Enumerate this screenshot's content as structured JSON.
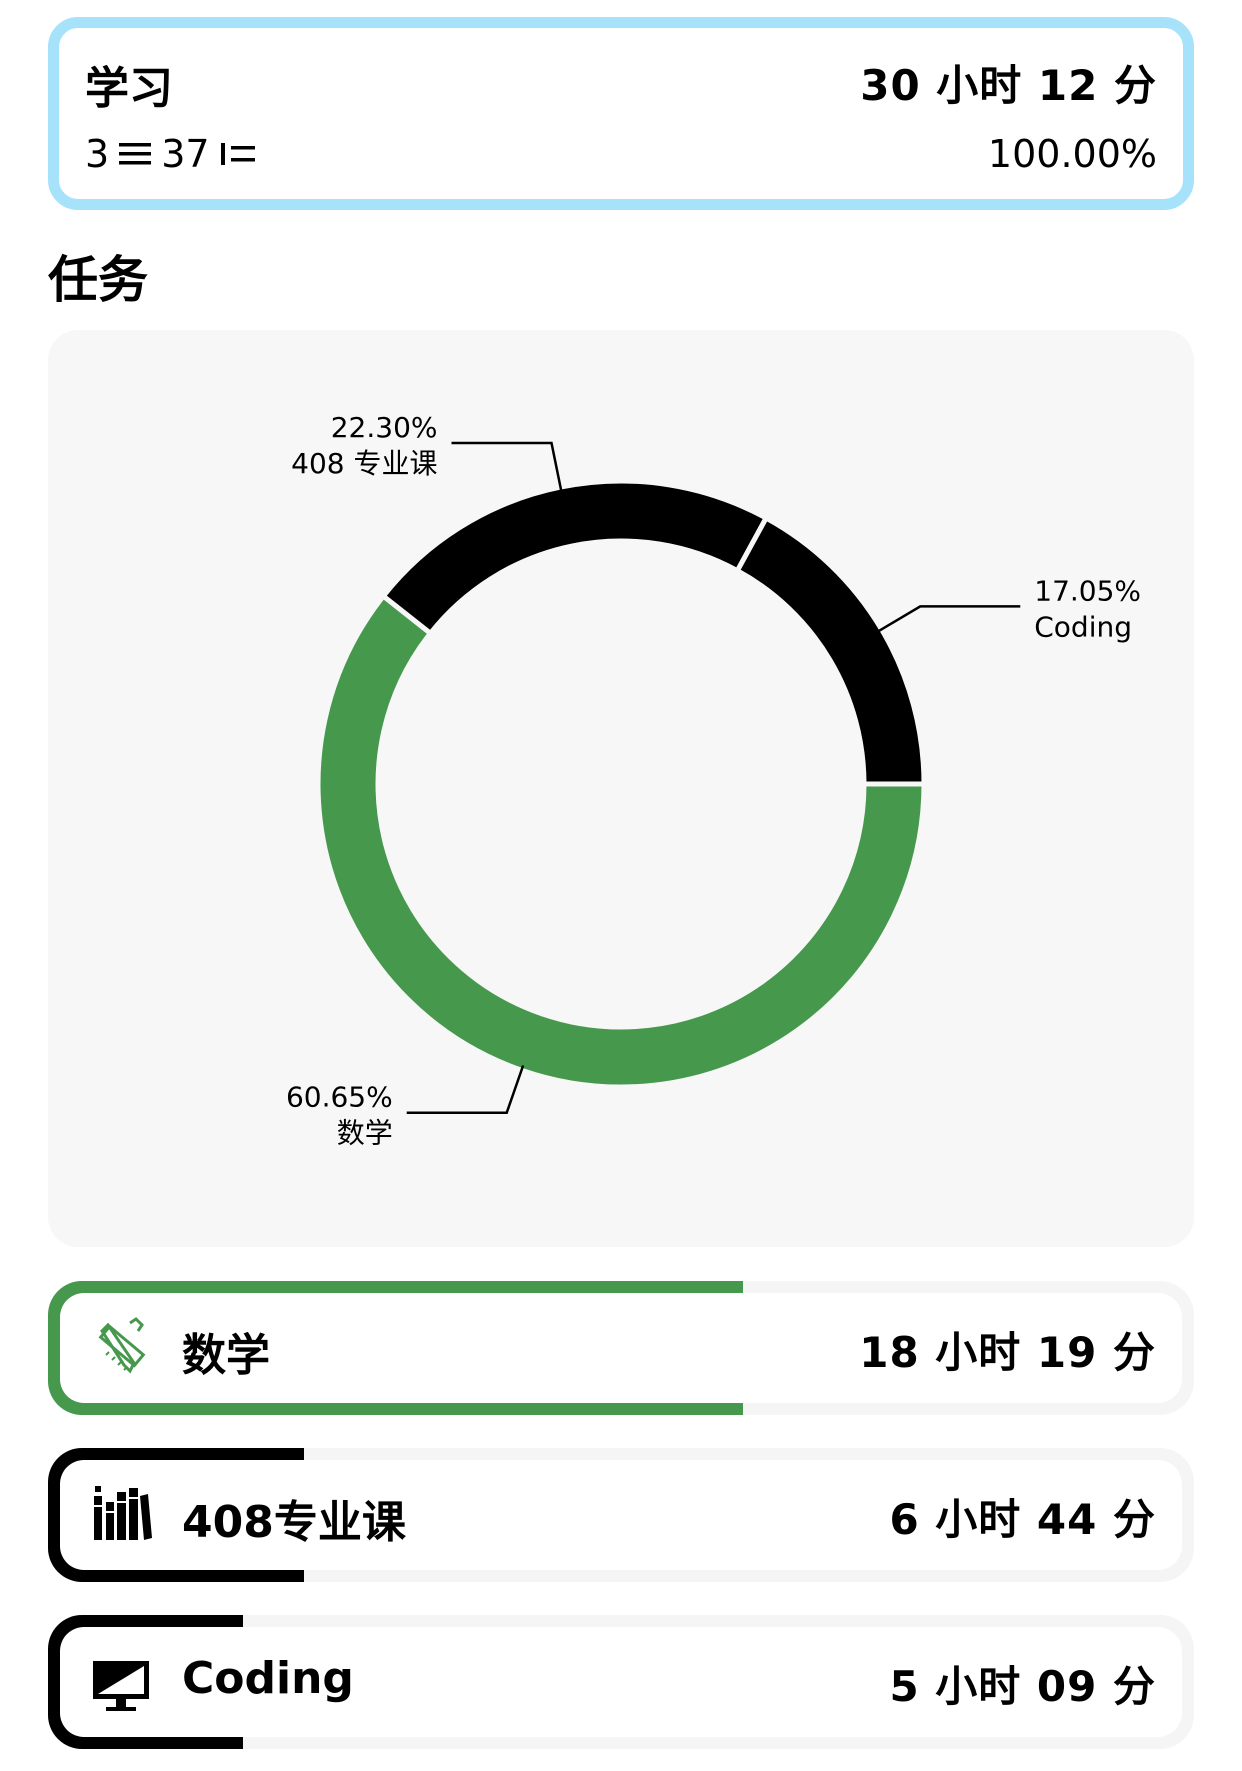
{
  "summary": {
    "title": "学习",
    "total_time": "30 小时 12 分",
    "task_count": "3",
    "record_count": "37",
    "percent": "100.00%",
    "border_color": "#a6e2fa"
  },
  "section": {
    "title": "任务"
  },
  "chart_data": {
    "type": "pie",
    "labels": [
      "数学",
      "408 专业课",
      "Coding"
    ],
    "values": [
      60.65,
      22.3,
      17.05
    ],
    "display": [
      "60.65%",
      "22.30%",
      "17.05%"
    ],
    "colors": [
      "#46994c",
      "#000000",
      "#000000"
    ],
    "donut": true,
    "start_angle": "3 o'clock, clockwise"
  },
  "tasks": [
    {
      "name": "数学",
      "time": "18 小时 19 分",
      "fraction": 0.6065,
      "color": "#46994c",
      "icon": "ruler-pencil-icon"
    },
    {
      "name": "408专业课",
      "time": "6 小时 44 分",
      "fraction": 0.223,
      "color": "#000000",
      "icon": "books-icon"
    },
    {
      "name": "Coding",
      "time": "5 小时 09 分",
      "fraction": 0.1705,
      "color": "#000000",
      "icon": "monitor-icon"
    }
  ]
}
